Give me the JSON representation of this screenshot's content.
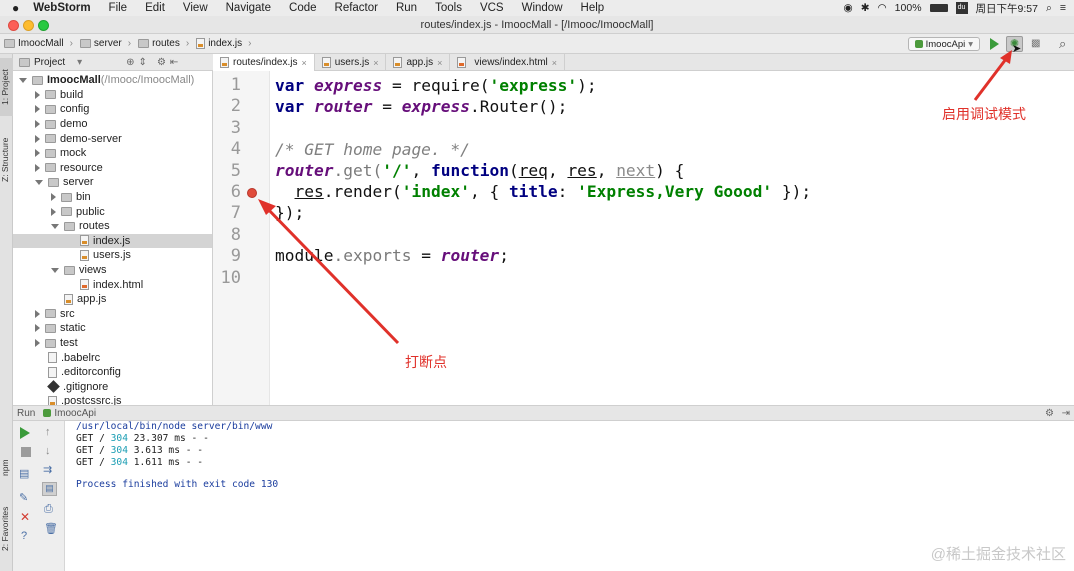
{
  "menubar": {
    "app": "WebStorm",
    "items": [
      "File",
      "Edit",
      "View",
      "Navigate",
      "Code",
      "Refactor",
      "Run",
      "Tools",
      "VCS",
      "Window",
      "Help"
    ],
    "battery": "100%",
    "clock": "周日下午9:57"
  },
  "window": {
    "title": "routes/index.js - ImoocMall - [/Imooc/ImoocMall]"
  },
  "breadcrumb": [
    "ImoocMall",
    "server",
    "routes",
    "index.js"
  ],
  "run_config": {
    "label": "ImoocApi"
  },
  "side_tabs": {
    "project": "1: Project",
    "structure": "Z: Structure",
    "npm": "npm",
    "favorites": "2: Favorites"
  },
  "project_panel": {
    "header": "Project",
    "tree": [
      {
        "label": "ImoocMall",
        "extra": "(/Imooc/ImoocMall)",
        "depth": 0,
        "kind": "folder",
        "state": "open"
      },
      {
        "label": "build",
        "depth": 1,
        "kind": "folder",
        "state": "closed"
      },
      {
        "label": "config",
        "depth": 1,
        "kind": "folder",
        "state": "closed"
      },
      {
        "label": "demo",
        "depth": 1,
        "kind": "folder",
        "state": "closed"
      },
      {
        "label": "demo-server",
        "depth": 1,
        "kind": "folder",
        "state": "closed"
      },
      {
        "label": "mock",
        "depth": 1,
        "kind": "folder",
        "state": "closed"
      },
      {
        "label": "resource",
        "depth": 1,
        "kind": "folder",
        "state": "closed"
      },
      {
        "label": "server",
        "depth": 1,
        "kind": "folder",
        "state": "open"
      },
      {
        "label": "bin",
        "depth": 2,
        "kind": "folder",
        "state": "closed"
      },
      {
        "label": "public",
        "depth": 2,
        "kind": "folder",
        "state": "closed"
      },
      {
        "label": "routes",
        "depth": 2,
        "kind": "folder",
        "state": "open"
      },
      {
        "label": "index.js",
        "depth": 3,
        "kind": "js",
        "state": "none",
        "selected": true
      },
      {
        "label": "users.js",
        "depth": 3,
        "kind": "js",
        "state": "none"
      },
      {
        "label": "views",
        "depth": 2,
        "kind": "folder",
        "state": "open"
      },
      {
        "label": "index.html",
        "depth": 3,
        "kind": "html",
        "state": "none"
      },
      {
        "label": "app.js",
        "depth": 2,
        "kind": "js",
        "state": "none"
      },
      {
        "label": "src",
        "depth": 1,
        "kind": "folder",
        "state": "closed"
      },
      {
        "label": "static",
        "depth": 1,
        "kind": "folder",
        "state": "closed"
      },
      {
        "label": "test",
        "depth": 1,
        "kind": "folder",
        "state": "closed"
      },
      {
        "label": ".babelrc",
        "depth": 1,
        "kind": "cfg",
        "state": "none"
      },
      {
        "label": ".editorconfig",
        "depth": 1,
        "kind": "cfg",
        "state": "none"
      },
      {
        "label": ".gitignore",
        "depth": 1,
        "kind": "git",
        "state": "none"
      },
      {
        "label": ".postcssrc.js",
        "depth": 1,
        "kind": "js",
        "state": "none"
      }
    ]
  },
  "editor_tabs": [
    {
      "label": "routes/index.js",
      "kind": "js",
      "active": true
    },
    {
      "label": "users.js",
      "kind": "js",
      "active": false
    },
    {
      "label": "app.js",
      "kind": "js",
      "active": false
    },
    {
      "label": "views/index.html",
      "kind": "html",
      "active": false
    }
  ],
  "editor": {
    "line_numbers": [
      "1",
      "2",
      "3",
      "4",
      "5",
      "6",
      "7",
      "8",
      "9",
      "10"
    ],
    "breakpoint_line": 6,
    "current_line": 7,
    "code": {
      "l1": [
        "var",
        "express",
        "=",
        "require(",
        "'express'",
        ");"
      ],
      "l2": [
        "var",
        "router",
        "=",
        "express",
        ".Router();"
      ],
      "l4": "/* GET home page. */",
      "l5": [
        "router",
        ".get(",
        "'/'",
        ", ",
        "function",
        "(",
        "req",
        ", ",
        "res",
        ", ",
        "next",
        ") {"
      ],
      "l6": [
        "res",
        ".render(",
        "'index'",
        ", { ",
        "title",
        ": ",
        "'Express,Very Goood'",
        " });"
      ],
      "l7": "});",
      "l9": [
        "module",
        ".exports",
        " = ",
        "router",
        ";"
      ]
    }
  },
  "run_panel": {
    "label": "Run",
    "config": "ImoocApi",
    "console": {
      "cmd": "/usr/local/bin/node server/bin/www",
      "requests": [
        {
          "prefix": "GET / ",
          "status": "304",
          "rest": " 23.307 ms - -"
        },
        {
          "prefix": "GET / ",
          "status": "304",
          "rest": " 3.613 ms - -"
        },
        {
          "prefix": "GET / ",
          "status": "304",
          "rest": " 1.611 ms - -"
        }
      ],
      "exit": "Process finished with exit code 130"
    }
  },
  "annotations": {
    "debug_mode": "启用调试模式",
    "breakpoint": "打断点"
  },
  "watermark": "@稀土掘金技术社区",
  "colors": {
    "annotation": "#e0312a",
    "breakpoint": "#e04b3b",
    "run_green": "#3a9b3a",
    "selection": "#d4d4d4"
  }
}
